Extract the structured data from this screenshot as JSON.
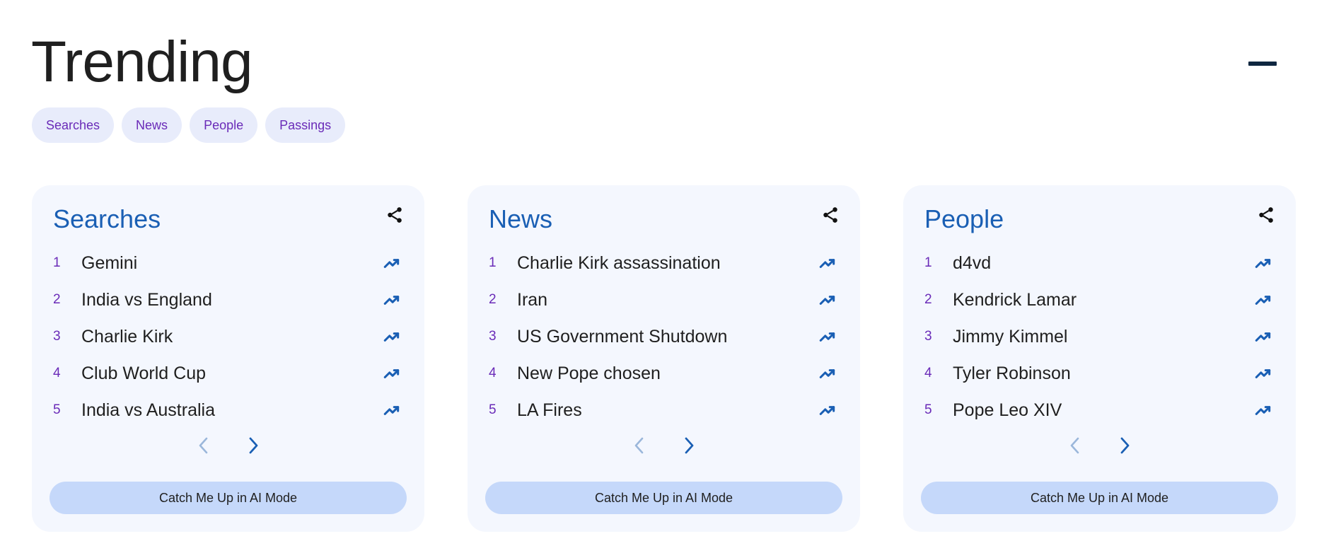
{
  "header": {
    "title": "Trending"
  },
  "chips": [
    {
      "label": "Searches"
    },
    {
      "label": "News"
    },
    {
      "label": "People"
    },
    {
      "label": "Passings"
    }
  ],
  "colors": {
    "accent_blue": "#1a5fb4",
    "rank_purple": "#6a2bb8",
    "chip_bg": "#e8ecfb",
    "card_bg": "#f4f7fe",
    "ai_button_bg": "#c5d8fa"
  },
  "cards": [
    {
      "title": "Searches",
      "items": [
        {
          "rank": "1",
          "term": "Gemini"
        },
        {
          "rank": "2",
          "term": "India vs England"
        },
        {
          "rank": "3",
          "term": "Charlie Kirk"
        },
        {
          "rank": "4",
          "term": "Club World Cup"
        },
        {
          "rank": "5",
          "term": "India vs Australia"
        }
      ],
      "ai_button": "Catch Me Up in AI Mode"
    },
    {
      "title": "News",
      "items": [
        {
          "rank": "1",
          "term": "Charlie Kirk assassination"
        },
        {
          "rank": "2",
          "term": "Iran"
        },
        {
          "rank": "3",
          "term": "US Government Shutdown"
        },
        {
          "rank": "4",
          "term": "New Pope chosen"
        },
        {
          "rank": "5",
          "term": "LA Fires"
        }
      ],
      "ai_button": "Catch Me Up in AI Mode"
    },
    {
      "title": "People",
      "items": [
        {
          "rank": "1",
          "term": "d4vd"
        },
        {
          "rank": "2",
          "term": "Kendrick Lamar"
        },
        {
          "rank": "3",
          "term": "Jimmy Kimmel"
        },
        {
          "rank": "4",
          "term": "Tyler Robinson"
        },
        {
          "rank": "5",
          "term": "Pope Leo XIV"
        }
      ],
      "ai_button": "Catch Me Up in AI Mode"
    }
  ],
  "icons": {
    "collapse": "minus-icon",
    "share": "share-icon",
    "trend": "trending-up-icon",
    "prev": "chevron-left-icon",
    "next": "chevron-right-icon"
  }
}
